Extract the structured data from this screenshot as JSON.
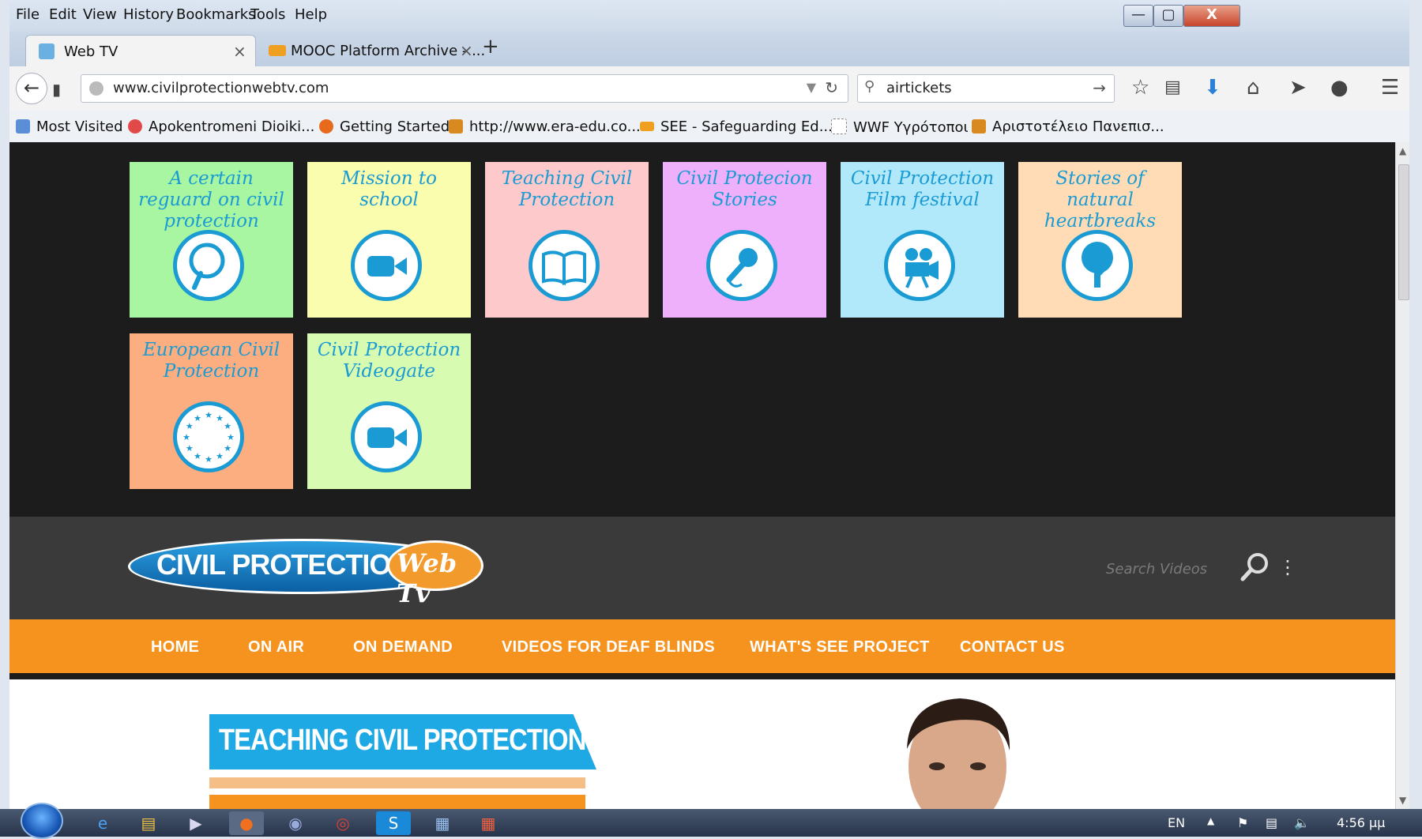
{
  "menu": [
    "File",
    "Edit",
    "View",
    "History",
    "Bookmarks",
    "Tools",
    "Help"
  ],
  "window_controls": {
    "minimize": "—",
    "maximize": "▢",
    "close": "X"
  },
  "tabs": [
    {
      "title": "Web TV",
      "close": "×"
    },
    {
      "title": "MOOC Platform Archive - ...",
      "close": "×"
    }
  ],
  "new_tab": "+",
  "url": "www.civilprotectionwebtv.com",
  "search_query": "airtickets",
  "bookmarks": [
    "Most Visited",
    "Apokentromeni Dioiki...",
    "Getting Started",
    "http://www.era-edu.co...",
    "SEE - Safeguarding Ed...",
    "WWF Υγρότοποι",
    "Αριστοτέλειο Πανεπισ..."
  ],
  "tiles": [
    {
      "label": "A certain reguard on civil protection",
      "bg": "#a8f5a2",
      "icon": "magnifier-icon"
    },
    {
      "label": "Mission to school",
      "bg": "#fafcae",
      "icon": "video-camera-icon"
    },
    {
      "label": "Teaching Civil Protection",
      "bg": "#fdc9cb",
      "icon": "book-icon"
    },
    {
      "label": "Civil Protecion Stories",
      "bg": "#eeb0fb",
      "icon": "microphone-icon"
    },
    {
      "label": "Civil Protection Film festival",
      "bg": "#b1e9fb",
      "icon": "film-projector-icon"
    },
    {
      "label": "Stories of natural heartbreaks",
      "bg": "#ffdcb6",
      "icon": "tree-icon"
    },
    {
      "label": "European Civil Protection",
      "bg": "#fdae80",
      "icon": "eu-stars-icon"
    },
    {
      "label": "Civil Protection Videogate",
      "bg": "#d7fbb1",
      "icon": "video-camera-icon"
    }
  ],
  "logo": {
    "main": "CIVIL PROTECTION",
    "badge": "Web Tv"
  },
  "search_videos_placeholder": "Search Videos",
  "nav": [
    "HOME",
    "ON AIR",
    "ON DEMAND",
    "VIDEOS FOR DEAF BLINDS",
    "WHAT'S SEE PROJECT",
    "CONTACT US"
  ],
  "banner_title": "TEACHING CIVIL PROTECTION",
  "taskbar": {
    "lang": "EN",
    "time": "4:56 μμ"
  },
  "colors": {
    "accent_orange": "#f6931e",
    "accent_blue": "#1b9bd3",
    "page_dark": "#1c1c1c",
    "header_gray": "#3a3a3a"
  }
}
